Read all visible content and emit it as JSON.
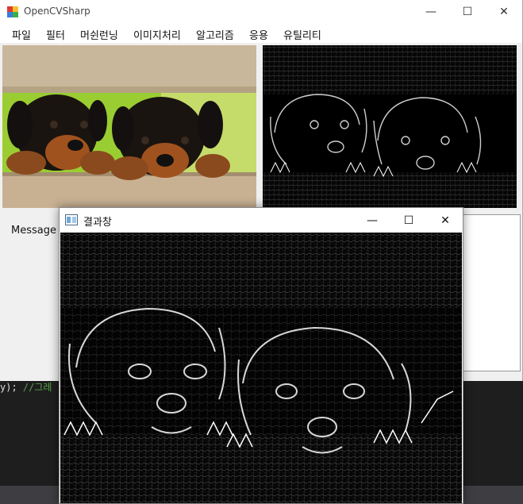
{
  "background_editor": {
    "code_text": "y);",
    "comment_text": " //그레"
  },
  "main_window": {
    "title": "OpenCVSharp",
    "controls": {
      "minimize": "—",
      "maximize": "☐",
      "close": "✕"
    },
    "menu": [
      "파일",
      "필터",
      "머쉰런닝",
      "이미지처리",
      "알고리즘",
      "응용",
      "유틸리티"
    ],
    "message_label": "Message :",
    "images": {
      "left": "puppies-photo",
      "right": "edge-filtered-photo"
    }
  },
  "result_window": {
    "title": "결과창",
    "controls": {
      "minimize": "—",
      "maximize": "☐",
      "close": "✕"
    },
    "image": "edge-filtered-photo-large"
  },
  "colors": {
    "editor_bg": "#1e1e1e",
    "comment": "#57a64a",
    "window_bg": "#f0f0f0",
    "fence_wood": "#c9b79c",
    "grass": "#9acd32",
    "puppy_dark": "#1a1410",
    "puppy_tan": "#a0521e"
  }
}
